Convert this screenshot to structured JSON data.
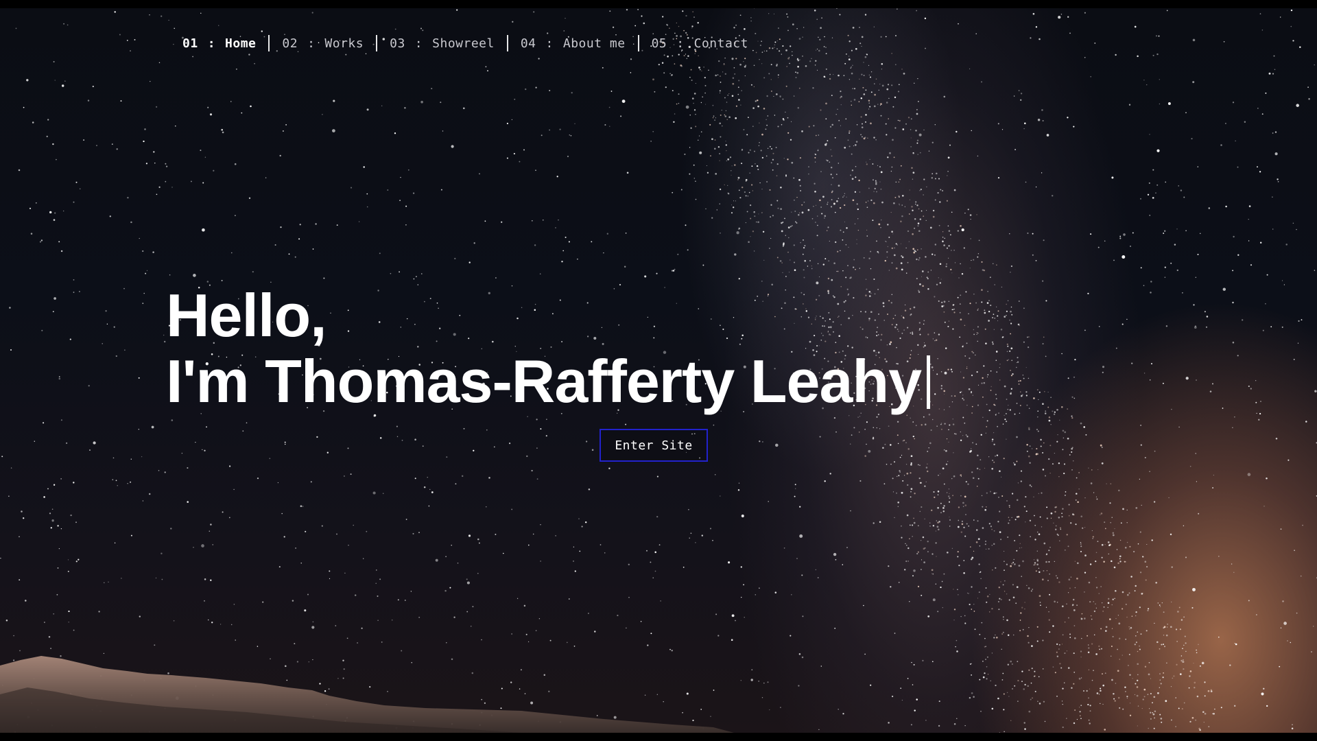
{
  "nav": {
    "items": [
      {
        "num": "01",
        "label": "Home",
        "active": true
      },
      {
        "num": "02",
        "label": "Works",
        "active": false
      },
      {
        "num": "03",
        "label": "Showreel",
        "active": false
      },
      {
        "num": "04",
        "label": "About me",
        "active": false
      },
      {
        "num": "05",
        "label": "Contact",
        "active": false
      }
    ],
    "separator": ":"
  },
  "hero": {
    "line1": "Hello,",
    "line2": "I'm Thomas-Rafferty Leahy"
  },
  "cta": {
    "label": "Enter Site",
    "border_color": "#2222cc"
  },
  "background": {
    "description_icon": "night-sky-milky-way-image"
  }
}
